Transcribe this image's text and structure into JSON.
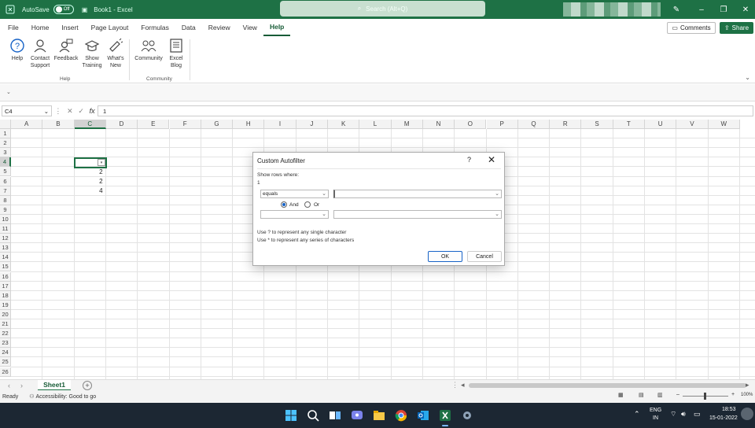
{
  "titlebar": {
    "autosave_label": "AutoSave",
    "autosave_state": "Off",
    "doc_title": "Book1  -  Excel",
    "search_placeholder": "Search (Alt+Q)"
  },
  "menu": {
    "tabs": [
      "File",
      "Home",
      "Insert",
      "Page Layout",
      "Formulas",
      "Data",
      "Review",
      "View",
      "Help"
    ],
    "active": "Help",
    "comments": "Comments",
    "share": "Share"
  },
  "ribbon": {
    "help_group": {
      "label": "Help",
      "buttons": [
        "Help",
        "Contact\nSupport",
        "Feedback",
        "Show\nTraining",
        "What's\nNew"
      ]
    },
    "community_group": {
      "label": "Community",
      "buttons": [
        "Community",
        "Excel\nBlog"
      ]
    }
  },
  "formula_bar": {
    "name_box": "C4",
    "formula": "1",
    "fx": "fx"
  },
  "grid": {
    "columns": [
      "A",
      "B",
      "C",
      "D",
      "E",
      "F",
      "G",
      "H",
      "I",
      "J",
      "K",
      "L",
      "M",
      "N",
      "O",
      "P",
      "Q",
      "R",
      "S",
      "T",
      "U",
      "V",
      "W"
    ],
    "rows": [
      "1",
      "2",
      "3",
      "4",
      "5",
      "6",
      "7",
      "8",
      "9",
      "10",
      "11",
      "12",
      "13",
      "14",
      "15",
      "16",
      "17",
      "18",
      "19",
      "20",
      "21",
      "22",
      "23",
      "24",
      "25",
      "26"
    ],
    "selected_col": "C",
    "selected_row": "4",
    "cells": [
      {
        "col": "C",
        "row": "5",
        "value": "2"
      },
      {
        "col": "C",
        "row": "6",
        "value": "2"
      },
      {
        "col": "C",
        "row": "7",
        "value": "4"
      }
    ]
  },
  "dialog": {
    "title": "Custom Autofilter",
    "help": "?",
    "close": "✕",
    "show_rows_label": "Show rows where:",
    "field_name": "1",
    "criteria1_operator": "equals",
    "criteria1_value": "",
    "and_label": "And",
    "or_label": "Or",
    "selected": "And",
    "criteria2_operator": "",
    "criteria2_value": "",
    "hint1": "Use ? to represent any single character",
    "hint2": "Use * to represent any series of characters",
    "ok": "OK",
    "cancel": "Cancel"
  },
  "sheets": {
    "tabs": [
      "Sheet1"
    ],
    "active": "Sheet1"
  },
  "status": {
    "mode": "Ready",
    "accessibility": "Accessibility: Good to go",
    "zoom": "100%"
  },
  "taskbar": {
    "lang1": "ENG",
    "lang2": "IN",
    "time": "18:53",
    "date": "15-01-2022"
  },
  "colors": {
    "excel_green": "#1e7145",
    "taskbar": "#1c2733",
    "accent_blue": "#1763c7"
  }
}
